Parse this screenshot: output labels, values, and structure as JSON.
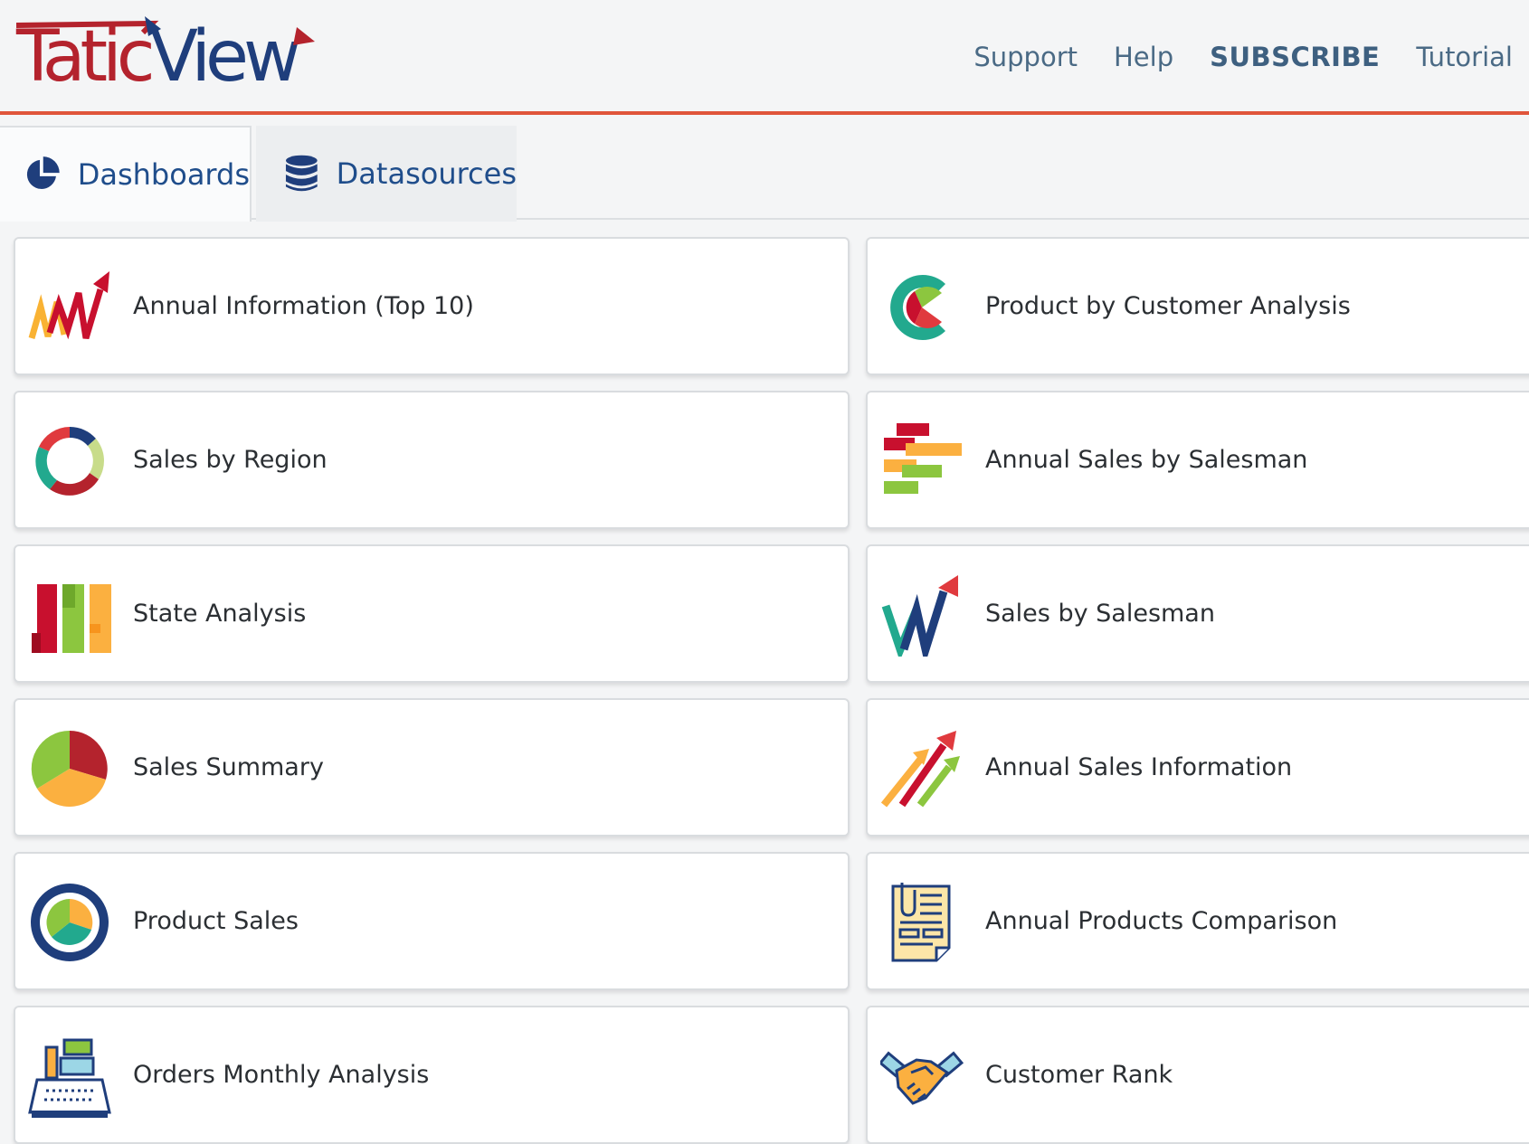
{
  "header": {
    "logo_text_red": "Tatic",
    "logo_text_blue": "View",
    "nav": [
      {
        "label": "Support"
      },
      {
        "label": "Help"
      },
      {
        "label": "SUBSCRIBE"
      },
      {
        "label": "Tutorial"
      }
    ]
  },
  "tabs": [
    {
      "label": "Dashboards",
      "icon": "pie-chart-icon",
      "active": true
    },
    {
      "label": "Datasources",
      "icon": "database-icon",
      "active": false
    }
  ],
  "dashboards": {
    "left": [
      {
        "title": "Annual Information (Top 10)",
        "icon": "trend-arrow-icon"
      },
      {
        "title": "Sales by Region",
        "icon": "donut-chart-icon"
      },
      {
        "title": "State Analysis",
        "icon": "bar-chart-icon"
      },
      {
        "title": "Sales Summary",
        "icon": "pie-chart-icon"
      },
      {
        "title": "Product Sales",
        "icon": "circle-pie-icon"
      },
      {
        "title": "Orders Monthly Analysis",
        "icon": "cash-register-icon"
      }
    ],
    "right": [
      {
        "title": "Product by Customer Analysis",
        "icon": "c-pie-icon"
      },
      {
        "title": "Annual Sales by Salesman",
        "icon": "gantt-bars-icon"
      },
      {
        "title": "Sales by Salesman",
        "icon": "w-arrow-icon"
      },
      {
        "title": "Annual Sales Information",
        "icon": "rising-arrows-icon"
      },
      {
        "title": "Annual Products Comparison",
        "icon": "document-icon"
      },
      {
        "title": "Customer Rank",
        "icon": "handshake-icon"
      }
    ]
  },
  "colors": {
    "accent_line": "#e0553b",
    "brand_red": "#b4232d",
    "brand_blue": "#1f3e7c",
    "tab_text": "#1f4d8b",
    "nav_text": "#4a6a85"
  }
}
